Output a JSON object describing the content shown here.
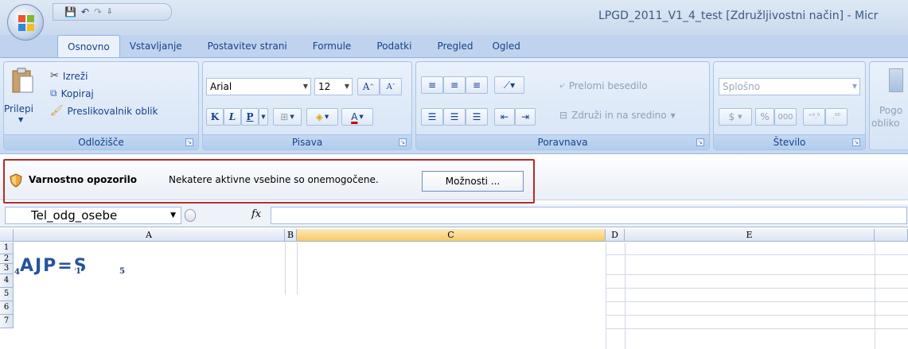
{
  "window": {
    "title": "LPGD_2011_V1_4_test  [Združljivostni način] - Micr"
  },
  "quick_access": {
    "save": "💾",
    "undo": "↶",
    "redo": "↷",
    "customize": "⇩"
  },
  "tabs": [
    "Osnovno",
    "Vstavljanje",
    "Postavitev strani",
    "Formule",
    "Podatki",
    "Pregled",
    "Ogled"
  ],
  "ribbon": {
    "clipboard": {
      "label": "Odložišče",
      "paste": "Prilepi",
      "cut": "Izreži",
      "copy": "Kopiraj",
      "format_painter": "Preslikovalnik oblik"
    },
    "font": {
      "label": "Pisava",
      "font_name": "Arial",
      "font_size": "12",
      "bold": "K",
      "italic": "L",
      "underline": "P"
    },
    "alignment": {
      "label": "Poravnava",
      "wrap_text": "Prelomi besedilo",
      "merge_center": "Združi in na sredino"
    },
    "number": {
      "label": "Število",
      "format": "Splošno",
      "currency": "$",
      "percent": "%",
      "thousands": "000",
      "inc_decimal": "⁺⁰.⁰",
      "dec_decimal": ".⁰⁰"
    },
    "styles": {
      "cond_format": "Pogo",
      "cond_format2": "obliko"
    }
  },
  "security": {
    "title": "Varnostno opozorilo",
    "message": "Nekatere aktivne vsebine so onemogočene.",
    "options": "Možnosti ..."
  },
  "formula_bar": {
    "name_box": "Tel_odg_osebe",
    "fx": "fx",
    "formula": ""
  },
  "columns": [
    "A",
    "B",
    "C",
    "D",
    "E"
  ],
  "rows": [
    "1",
    "2",
    "3",
    "4",
    "5",
    "6",
    "7"
  ],
  "cell_content": {
    "a2_main": "AJP=S",
    "sub_4": "4",
    "sub_1": "1",
    "sub_5": "5"
  }
}
